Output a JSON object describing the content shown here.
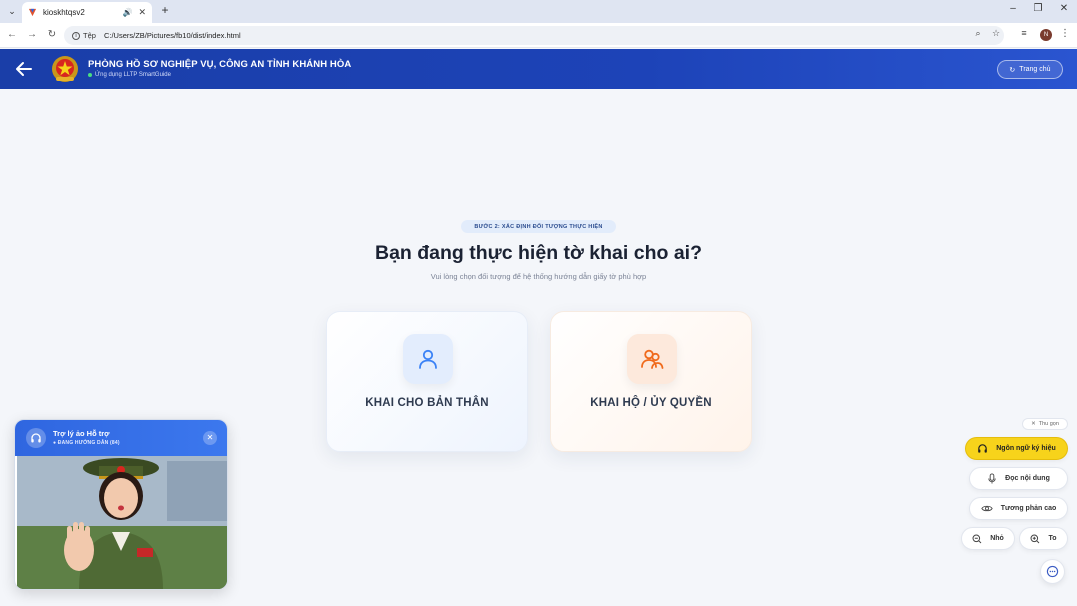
{
  "browser": {
    "tab_title": "kioskhtqsv2",
    "address_scheme": "Tệp",
    "address_url": "C:/Users/ZB/Pictures/fb10/dist/index.html",
    "profile_initial": "N"
  },
  "header": {
    "org_name": "PHÒNG HỒ SƠ NGHIỆP VỤ, CÔNG AN TỈNH KHÁNH HÒA",
    "app_name": "Ứng dụng LLTP SmartGuide",
    "home_label": "Trang chủ"
  },
  "main": {
    "step_badge": "BƯỚC 2: XÁC ĐỊNH ĐỐI TƯỢNG THỰC HIỆN",
    "title": "Bạn đang thực hiện tờ khai cho ai?",
    "subtitle": "Vui lòng chọn đối tượng để hệ thống hướng dẫn giấy tờ phù hợp",
    "options": [
      {
        "label": "KHAI CHO BẢN THÂN",
        "icon": "user-icon",
        "accent": "#3b82f6"
      },
      {
        "label": "KHAI HỘ / ỦY QUYỀN",
        "icon": "users-icon",
        "accent": "#f06a1c"
      }
    ]
  },
  "assistant": {
    "title": "Trợ lý ảo Hỗ trợ",
    "status": "● ĐANG HƯỚNG DẪN (84)"
  },
  "accessibility": {
    "collapse_label": "Thu gọn",
    "sign_language": "Ngôn ngữ ký hiệu",
    "read_content": "Đọc nội dung",
    "high_contrast": "Tương phản cao",
    "text_small": "Nhỏ",
    "text_large": "To"
  },
  "colors": {
    "header_blue": "#1d43b8",
    "sign_language_yellow": "#f7d31b"
  }
}
